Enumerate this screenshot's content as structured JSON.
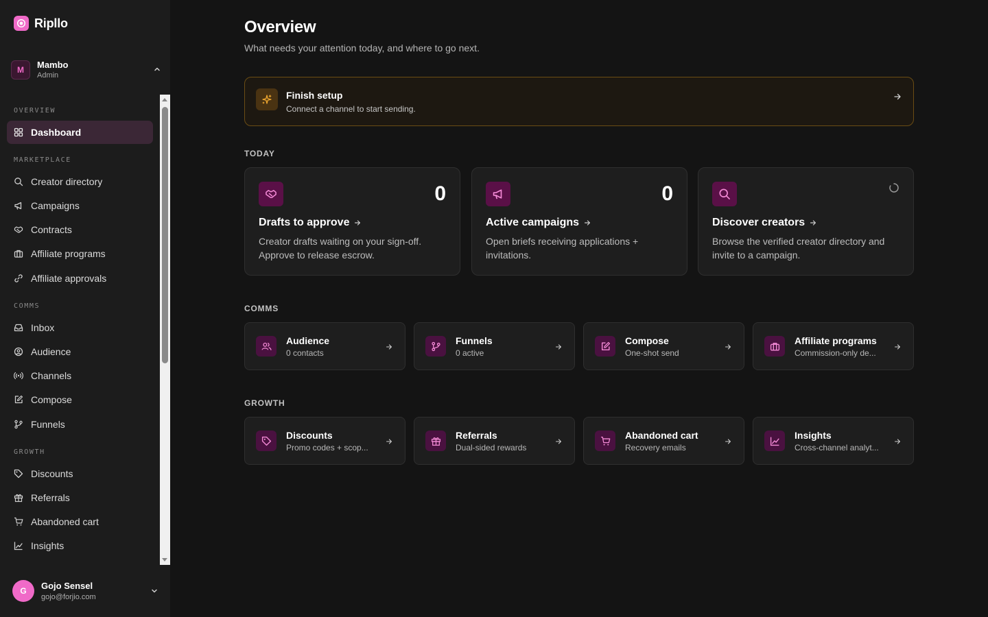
{
  "brand": {
    "name": "Ripllo",
    "icon": "brand-logo-icon",
    "accent": "#f06ac8"
  },
  "workspace": {
    "initial": "M",
    "name": "Mambo",
    "role": "Admin"
  },
  "sidebar": {
    "sections": [
      {
        "label": "OVERVIEW",
        "items": [
          {
            "label": "Dashboard",
            "icon": "grid-icon",
            "active": true
          }
        ]
      },
      {
        "label": "MARKETPLACE",
        "items": [
          {
            "label": "Creator directory",
            "icon": "search-icon"
          },
          {
            "label": "Campaigns",
            "icon": "megaphone-icon"
          },
          {
            "label": "Contracts",
            "icon": "handshake-icon"
          },
          {
            "label": "Affiliate programs",
            "icon": "briefcase-icon"
          },
          {
            "label": "Affiliate approvals",
            "icon": "link-icon"
          }
        ]
      },
      {
        "label": "COMMS",
        "items": [
          {
            "label": "Inbox",
            "icon": "inbox-icon"
          },
          {
            "label": "Audience",
            "icon": "user-circle-icon"
          },
          {
            "label": "Channels",
            "icon": "broadcast-icon"
          },
          {
            "label": "Compose",
            "icon": "edit-icon"
          },
          {
            "label": "Funnels",
            "icon": "branch-icon"
          }
        ]
      },
      {
        "label": "GROWTH",
        "items": [
          {
            "label": "Discounts",
            "icon": "tag-icon"
          },
          {
            "label": "Referrals",
            "icon": "gift-icon"
          },
          {
            "label": "Abandoned cart",
            "icon": "cart-icon"
          },
          {
            "label": "Insights",
            "icon": "chart-icon"
          }
        ]
      }
    ]
  },
  "user": {
    "initial": "G",
    "name": "Gojo Sensel",
    "email": "gojo@forjio.com"
  },
  "main": {
    "title": "Overview",
    "subtitle": "What needs your attention today, and where to go next.",
    "setup": {
      "title": "Finish setup",
      "description": "Connect a channel to start sending.",
      "icon": "sparkle-icon"
    },
    "today": {
      "label": "TODAY",
      "cards": [
        {
          "title": "Drafts to approve",
          "description": "Creator drafts waiting on your sign-off. Approve to release escrow.",
          "count": "0",
          "icon": "handshake-icon"
        },
        {
          "title": "Active campaigns",
          "description": "Open briefs receiving applications + invitations.",
          "count": "0",
          "icon": "megaphone-icon"
        },
        {
          "title": "Discover creators",
          "description": "Browse the verified creator directory and invite to a campaign.",
          "count": "",
          "icon": "search-icon",
          "loading": true
        }
      ]
    },
    "comms": {
      "label": "COMMS",
      "tiles": [
        {
          "title": "Audience",
          "subtitle": "0 contacts",
          "icon": "users-icon"
        },
        {
          "title": "Funnels",
          "subtitle": "0 active",
          "icon": "branch-icon"
        },
        {
          "title": "Compose",
          "subtitle": "One-shot send",
          "icon": "edit-icon"
        },
        {
          "title": "Affiliate programs",
          "subtitle": "Commission-only de...",
          "icon": "briefcase-icon"
        }
      ]
    },
    "growth": {
      "label": "GROWTH",
      "tiles": [
        {
          "title": "Discounts",
          "subtitle": "Promo codes + scop...",
          "icon": "tag-icon"
        },
        {
          "title": "Referrals",
          "subtitle": "Dual-sided rewards",
          "icon": "gift-icon"
        },
        {
          "title": "Abandoned cart",
          "subtitle": "Recovery emails",
          "icon": "cart-icon"
        },
        {
          "title": "Insights",
          "subtitle": "Cross-channel analyt...",
          "icon": "chart-icon"
        }
      ]
    }
  },
  "colors": {
    "background": "#141414",
    "sidebar": "#1c1c1c",
    "accent": "#f06ac8",
    "active_nav": "#3b2736",
    "setup_border": "#6b4d14"
  }
}
